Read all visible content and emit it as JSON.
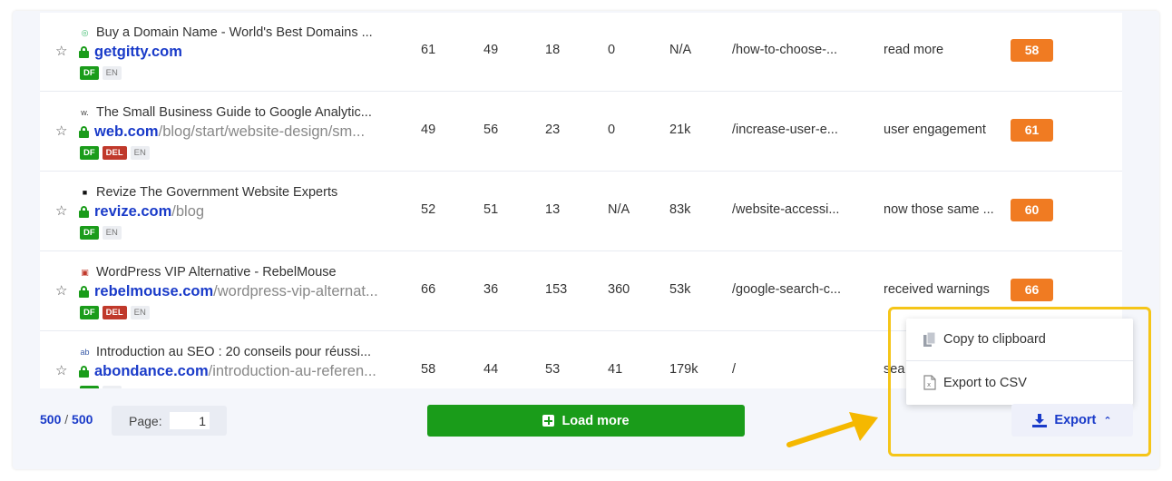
{
  "rows": [
    {
      "favicon": "◎",
      "favicon_color": "#3dbb6e",
      "title": "Buy a Domain Name - World's Best Domains ...",
      "domain": "getgitty.com",
      "path": "",
      "badges": [
        "DF",
        "EN"
      ],
      "c1": "61",
      "c2": "49",
      "c3": "18",
      "c4": "0",
      "c5": "N/A",
      "target": "/how-to-choose-...",
      "anchor": "read more",
      "score": "58"
    },
    {
      "favicon": "w.",
      "favicon_color": "#444444",
      "title": "The Small Business Guide to Google Analytic...",
      "domain": "web.com",
      "path": "/blog/start/website-design/sm...",
      "badges": [
        "DF",
        "DEL",
        "EN"
      ],
      "c1": "49",
      "c2": "56",
      "c3": "23",
      "c4": "0",
      "c5": "21k",
      "target": "/increase-user-e...",
      "anchor": "user engagement",
      "score": "61"
    },
    {
      "favicon": "■",
      "favicon_color": "#111111",
      "title": "Revize The Government Website Experts",
      "domain": "revize.com",
      "path": "/blog",
      "badges": [
        "DF",
        "EN"
      ],
      "c1": "52",
      "c2": "51",
      "c3": "13",
      "c4": "N/A",
      "c5": "83k",
      "target": "/website-accessi...",
      "anchor": "now those same ...",
      "score": "60"
    },
    {
      "favicon": "▣",
      "favicon_color": "#c0392b",
      "title": "WordPress VIP Alternative - RebelMouse",
      "domain": "rebelmouse.com",
      "path": "/wordpress-vip-alternat...",
      "badges": [
        "DF",
        "DEL",
        "EN"
      ],
      "c1": "66",
      "c2": "36",
      "c3": "153",
      "c4": "360",
      "c5": "53k",
      "target": "/google-search-c...",
      "anchor": "received warnings",
      "score": "66"
    },
    {
      "favicon": "ab",
      "favicon_color": "#3a5ba8",
      "title": "Introduction au SEO : 20 conseils pour réussi...",
      "domain": "abondance.com",
      "path": "/introduction-au-referen...",
      "badges": [
        "DF",
        "EN"
      ],
      "c1": "58",
      "c2": "44",
      "c3": "53",
      "c4": "41",
      "c5": "179k",
      "target": "/",
      "anchor": "sea",
      "score": ""
    }
  ],
  "footer": {
    "count_loaded": "500",
    "count_sep": "/",
    "count_total": "500",
    "page_label": "Page:",
    "page_value": "1",
    "load_more_label": "Load more",
    "export_label": "Export"
  },
  "export_menu": {
    "copy_label": "Copy to clipboard",
    "csv_label": "Export to CSV"
  },
  "colors": {
    "link": "#1a3bc9",
    "green": "#1a9c1a",
    "score": "#f07b22",
    "highlight": "#f5c518"
  }
}
